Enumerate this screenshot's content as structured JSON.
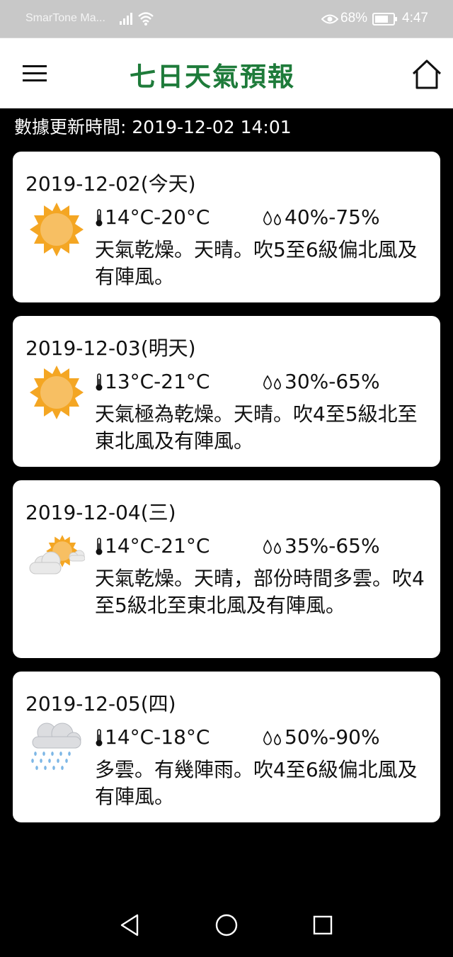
{
  "status_bar": {
    "carrier": "SmarTone Ma...",
    "battery_pct": "68%",
    "time": "4:47"
  },
  "header": {
    "title": "七日天氣預報"
  },
  "update": {
    "text": "數據更新時間: 2019-12-02 14:01"
  },
  "forecasts": [
    {
      "date": "2019-12-02(今天)",
      "icon": "sunny-icon",
      "temp": "14°C-20°C",
      "humidity": "40%-75%",
      "desc": "天氣乾燥。天晴。吹5至6級偏北風及有陣風。"
    },
    {
      "date": "2019-12-03(明天)",
      "icon": "sunny-icon",
      "temp": "13°C-21°C",
      "humidity": "30%-65%",
      "desc": "天氣極為乾燥。天晴。吹4至5級北至東北風及有陣風。"
    },
    {
      "date": "2019-12-04(三)",
      "icon": "sunny-periods-icon",
      "temp": "14°C-21°C",
      "humidity": "35%-65%",
      "desc": "天氣乾燥。天晴，部份時間多雲。吹4至5級北至東北風及有陣風。"
    },
    {
      "date": "2019-12-05(四)",
      "icon": "rain-icon",
      "temp": "14°C-18°C",
      "humidity": "50%-90%",
      "desc": "多雲。有幾陣雨。吹4至6級偏北風及有陣風。"
    }
  ],
  "colors": {
    "title_green": "#1e7b3a",
    "background": "#000000",
    "card": "#ffffff"
  }
}
